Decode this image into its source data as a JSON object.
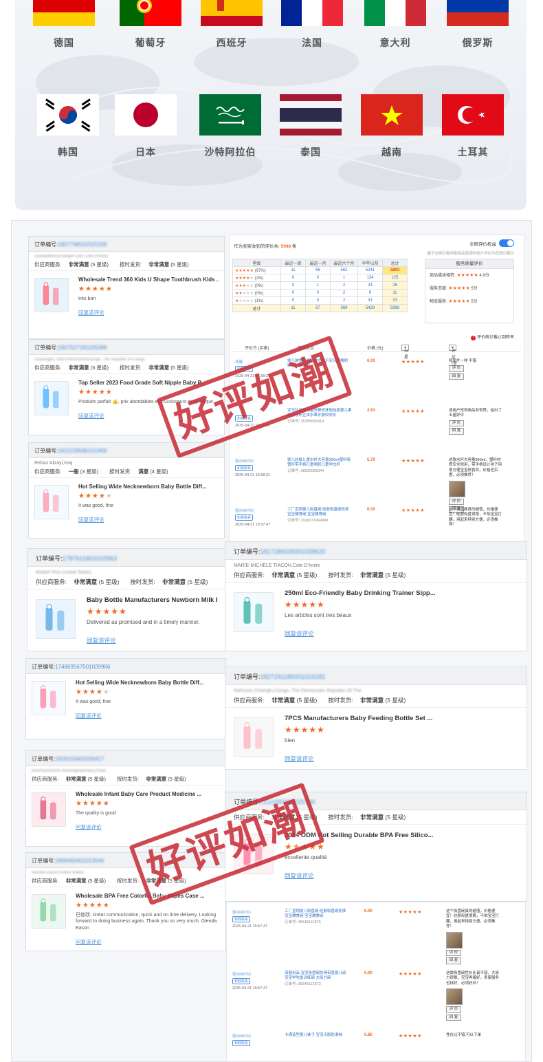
{
  "flags_top_row": [
    {
      "country": "德国",
      "icon": "germany-flag"
    },
    {
      "country": "葡萄牙",
      "icon": "portugal-flag"
    },
    {
      "country": "西班牙",
      "icon": "spain-flag"
    },
    {
      "country": "法国",
      "icon": "france-flag"
    },
    {
      "country": "意大利",
      "icon": "italy-flag"
    },
    {
      "country": "俄罗斯",
      "icon": "russia-flag"
    }
  ],
  "flags_bottom_row": [
    {
      "country": "韩国",
      "icon": "korea-flag"
    },
    {
      "country": "日本",
      "icon": "japan-flag"
    },
    {
      "country": "沙特阿拉伯",
      "icon": "saudi-arabia-flag"
    },
    {
      "country": "泰国",
      "icon": "thailand-flag"
    },
    {
      "country": "越南",
      "icon": "vietnam-flag"
    },
    {
      "country": "土耳其",
      "icon": "turkey-flag"
    }
  ],
  "labels": {
    "order_no": "订单编号:",
    "supplier_service": "供应商服务:",
    "on_time": "按时发货:",
    "reply": "回复该评论"
  },
  "panels": [
    {
      "order_id": "1807798502025209",
      "buyer": "Gueladifkensa kweph Gelo Cote d'Ivoire",
      "service": "非常满意",
      "service_level": "(5 星级)",
      "ship": "非常满意",
      "ship_level": "(5 星级)",
      "title": "Wholesale Trend 360 Kids U Shape Toothbrush Kids ...",
      "stars": 5,
      "comment": "très bon"
    },
    {
      "order_id": "1807527181026399",
      "buyer": "Guylungen, ANGUNKISDONGOngo, The Republic of Congo",
      "service": "非常满意",
      "service_level": "(5 星级)",
      "ship": "非常满意",
      "ship_level": "(5 星级)",
      "title": "Top Seller 2023 Food Grade Soft Nipple Baby P...",
      "stars": 5,
      "comment": "Produits parfait 👍, prix abordables et fournisseurs magnetique"
    },
    {
      "order_id": "1815239580102469",
      "buyer": "Rebaz Akrayi,Iraq",
      "service": "一般",
      "service_level": "(3 星级)",
      "ship": "满意",
      "ship_level": "(4 星级)",
      "title": "Hot Selling Wide Necknewborn Baby Bottle Diff...",
      "stars": 4,
      "comment": "It was good, fine"
    },
    {
      "order_id": "1787611802102963",
      "buyer": "Robert Pinc,United States",
      "service": "非常满意",
      "service_level": "(5 星级)",
      "ship": "非常满意",
      "ship_level": "(5 星级)",
      "title": "Baby Bottle Manufacturers Newborn Milk Bottl...",
      "stars": 5,
      "comment": "Delivered as promised and in a timely manner."
    },
    {
      "order_id": "174869567501020966",
      "buyer": "",
      "service": "",
      "service_level": "",
      "ship": "",
      "ship_level": "",
      "title": "Hot Selling Wide Necknewborn Baby Bottle Diff...",
      "stars": 4,
      "comment": "It was good, fine"
    },
    {
      "order_id": "1826153402026417",
      "buyer": "pharmactoroom medicalpharmacy,Oman",
      "service": "非常满意",
      "service_level": "(5 星级)",
      "ship": "非常满意",
      "ship_level": "(5 星级)",
      "title": "Wholesale Infant Baby Care Product Medicine ...",
      "stars": 5,
      "comment": "The quality is good"
    },
    {
      "order_id": "1806463401023046",
      "buyer": "Glenda Eason,United States",
      "service": "非常满意",
      "service_level": "(5 星级)",
      "ship": "非常满意",
      "ship_level": "(5 星级)",
      "title": "Wholesale BPA Free Colorful Baby Wipes Case ...",
      "stars": 5,
      "comment": "已修改: Great communication, quick and on time delivery. Looking forward to doing business again. Thank you so very much. Glenda Eason"
    },
    {
      "order_id": "1817286026001028620",
      "buyer": "MARIE-MICHELE TIACOH,Cote D'Ivoire",
      "service": "非常满意",
      "service_level": "(5 星级)",
      "ship": "非常满意",
      "ship_level": "(5 星级)",
      "title": "250ml Eco-Friendly Baby Drinking Trainer Sipp...",
      "stars": 5,
      "comment": "Les articles sont tres beaux"
    },
    {
      "order_id": "1827291185001024182",
      "buyer": "Nahusse Chiangfu,Congo, The Democratic Republic Of The",
      "service": "非常满意",
      "service_level": "(5 星级)",
      "ship": "非常满意",
      "ship_level": "(5 星级)",
      "title": "7PCS Manufacturers Baby Feeding Bottle Set ...",
      "stars": 5,
      "comment": "bien"
    },
    {
      "order_id": "1810290028025000",
      "buyer": "",
      "service": "非常满意",
      "service_level": "(5 星级)",
      "ship": "非常满意",
      "ship_level": "(5 星级)",
      "title": "2024 ODM Hot Selling Durable BPA Free Silico...",
      "stars": 5,
      "comment": "excellente qualité"
    }
  ],
  "stats": {
    "received_prefix": "作为卖家收到的评价共:",
    "received_count": "5998",
    "received_suffix": "条",
    "toggle_label": "全网评价权益",
    "note": "基于全网已售同款商品获得的用户评价为您进行展示",
    "headers": [
      "星级",
      "最近一周",
      "最近一月",
      "最近六个月",
      "半年以前",
      "总计"
    ],
    "rows": [
      {
        "stars": 5,
        "pct": "(97%)",
        "w": "11",
        "m": "66",
        "h": "562",
        "old": "5241",
        "total": "5803"
      },
      {
        "stars": 4,
        "pct": "(2%)",
        "w": "0",
        "m": "0",
        "h": "1",
        "old": "124",
        "total": "125"
      },
      {
        "stars": 3,
        "pct": "(0%)",
        "w": "0",
        "m": "1",
        "h": "2",
        "old": "24",
        "total": "26"
      },
      {
        "stars": 2,
        "pct": "(0%)",
        "w": "0",
        "m": "0",
        "h": "2",
        "old": "9",
        "total": "11"
      },
      {
        "stars": 1,
        "pct": "(1%)",
        "w": "0",
        "m": "0",
        "h": "2",
        "old": "31",
        "total": "33"
      }
    ],
    "sum_row": {
      "label": "总计",
      "w": "11",
      "m": "67",
      "h": "569",
      "old": "5429",
      "total": "5998"
    },
    "service_title": "服务质量评价",
    "service_rows": [
      {
        "label": "商品描述相符:",
        "value": "4.9分"
      },
      {
        "label": "服务态度:",
        "value": "5分"
      },
      {
        "label": "物流服务:",
        "value": "5分"
      }
    ],
    "eval_note": "评价统计截止到昨天",
    "list_headers": [
      "评价方 (买家)",
      "商品信息",
      "价格 (元)",
      "五星",
      "评论(全部)"
    ],
    "list_rows": [
      {
        "buyer": "洗睡",
        "contact": "和我联系",
        "date": "2025-04-21 15:58:31",
        "prod": "婴儿辅食奶瓶硅胶咬咬乐安抚奶嘴刷 婴幼儿护牙刷",
        "oid": "",
        "price": "6.00",
        "cmt": "和图片一样 不错",
        "btns": [
          "评 价",
          "回 复"
        ],
        "img": false
      },
      {
        "buyer": "",
        "contact": "和我联系",
        "date": "2025-04-22 15:58:31",
        "prod": "宝宝硅胶婴儿磨牙棒安抚软硅胶婴儿果蔬咬咬乐立体水果牙胶咬咬乐",
        "oid": "订单号: 25355695419",
        "price": "2.63",
        "cmt": "该用户觉得商品非常赞，给出了五星好评",
        "btns": [
          "评 价",
          "回 复"
        ],
        "img": false
      },
      {
        "buyer": "张2448763",
        "contact": "和我联系",
        "date": "2025-04-21 15:58:31",
        "prod": "婴儿硅胶儿童水杯大容量300ml塑料吸管杯带手柄儿童喝奶儿童学饮杯",
        "oid": "订单号: 36530055844",
        "price": "5.70",
        "cmt": "这款水杯大容量300ml，塑料材质安全耐用，带手柄设计孩子用很方便宝宝很喜欢，价格也实惠，必须推荐！",
        "btns": [
          "评 价",
          "回 复"
        ],
        "img": true
      },
      {
        "buyer": "张2448763",
        "contact": "和我联系",
        "date": "2025-04-21 15:57:47",
        "prod": "工厂直销婴儿吸盘碗 硅胶吸盘碗防摔宝宝辅食碗 宝宝辅食碗",
        "oid": "订单号: 2026071494499",
        "price": "6.00",
        "cmt": "这个吸盘碗真的超值，价格便宜！硅胶吸盘很稳，不怕宝宝打翻，用起来特别方便，必须推荐！",
        "btns": [],
        "img": false
      },
      {
        "buyer": "张2448763",
        "contact": "和我联系",
        "date": "2025-04-21 15:57:47",
        "prod": "工厂直销婴儿吸盘碗 硅胶吸盘碗防摔宝宝辅食碗 宝宝辅食碗",
        "oid": "订单号: 36548112875",
        "price": "6.00",
        "cmt": "这个吸盘碗真的超值，价格便宜！硅胶吸盘很稳，不怕宝宝打翻，用起来特别方便，必须推荐！",
        "btns": [
          "评 价",
          "回 复"
        ],
        "img": true
      },
      {
        "buyer": "张2448763",
        "contact": "和我联系",
        "date": "2025-04-21 15:57:47",
        "prod": "母婴用品 宝宝吸盘碗防滑带盖婴儿碗宝宝学吃饭训练碗 大吸力碗",
        "oid": "订单号: 36548112873",
        "price": "6.00",
        "cmt": "这款吸盘碗性价比真不错，大吸力很稳，宝宝再着好，卖家服务也特好，必须好评！",
        "btns": [
          "评 价",
          "回 复"
        ],
        "img": true
      },
      {
        "buyer": "张2448763",
        "contact": "和我联系",
        "date": "",
        "prod": "卡通造型婴儿袜子 宝宝点胶防滑袜",
        "oid": "",
        "price": "0.85",
        "cmt": "性价比不错,可以下单",
        "btns": [],
        "img": false
      }
    ]
  },
  "watermark_text": "好评如潮"
}
